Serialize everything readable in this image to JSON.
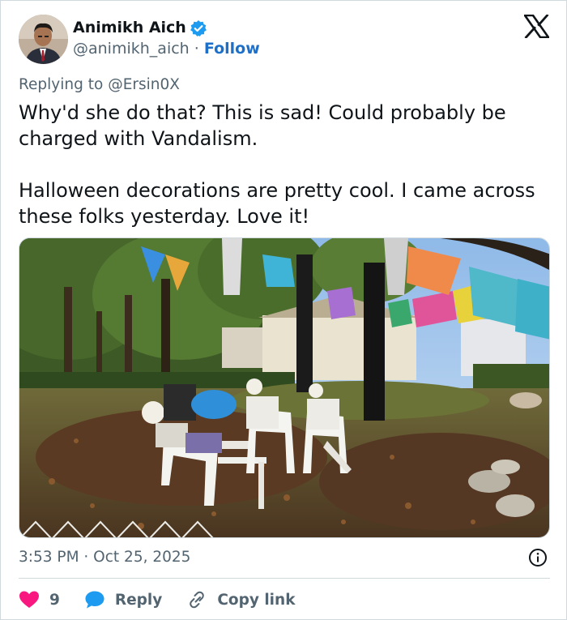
{
  "author": {
    "name": "Animikh Aich",
    "handle": "@animikh_aich",
    "separator": "·",
    "follow_label": "Follow",
    "verified": true,
    "avatar_icon": "profile-photo"
  },
  "platform_icon": "x-logo-icon",
  "reply_prefix": "Replying to",
  "reply_mention": "@Ersin0X",
  "text": "Why'd she do that? This is sad! Could probably be charged with Vandalism.\n\nHalloween decorations are pretty cool. I came across these folks yesterday. Love it!",
  "timestamp": "3:53 PM · Oct 25, 2025",
  "actions": {
    "like_count": "9",
    "reply_label": "Reply",
    "copy_label": "Copy link"
  },
  "colors": {
    "accent": "#1d6fc7",
    "like": "#f91880",
    "muted": "#536471"
  }
}
